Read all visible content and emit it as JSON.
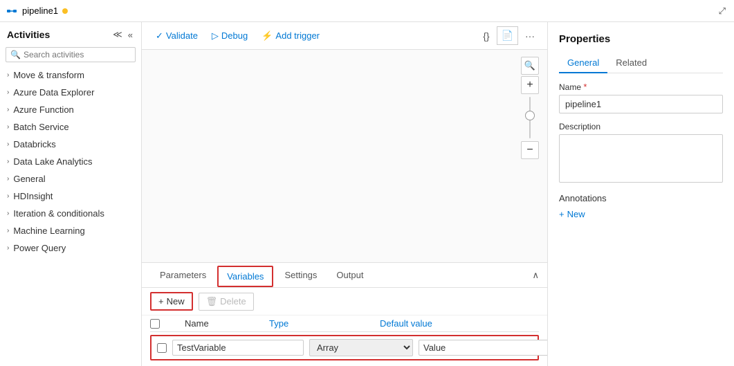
{
  "titleBar": {
    "icon": "pipeline-icon",
    "title": "pipeline1",
    "dot": true,
    "maximizeBtn": "⤢",
    "moreBtn": "..."
  },
  "toolbar": {
    "validateLabel": "Validate",
    "debugLabel": "Debug",
    "addTriggerLabel": "Add trigger",
    "codeBtn": "{}",
    "docBtn": "📄",
    "moreBtn": "···"
  },
  "sidebar": {
    "title": "Activities",
    "searchPlaceholder": "Search activities",
    "collapseBtn": "«",
    "expandBtn": "≪",
    "items": [
      {
        "label": "Move & transform"
      },
      {
        "label": "Azure Data Explorer"
      },
      {
        "label": "Azure Function"
      },
      {
        "label": "Batch Service"
      },
      {
        "label": "Databricks"
      },
      {
        "label": "Data Lake Analytics"
      },
      {
        "label": "General"
      },
      {
        "label": "HDInsight"
      },
      {
        "label": "Iteration & conditionals"
      },
      {
        "label": "Machine Learning"
      },
      {
        "label": "Power Query"
      }
    ]
  },
  "bottomPanel": {
    "tabs": [
      {
        "label": "Parameters",
        "active": false
      },
      {
        "label": "Variables",
        "active": true
      },
      {
        "label": "Settings",
        "active": false
      },
      {
        "label": "Output",
        "active": false
      }
    ],
    "newBtn": "+ New",
    "deleteBtn": "Delete",
    "table": {
      "headers": [
        "Name",
        "Type",
        "Default value"
      ],
      "rows": [
        {
          "name": "TestVariable",
          "type": "Array",
          "default": "Value"
        }
      ]
    }
  },
  "properties": {
    "title": "Properties",
    "tabs": [
      {
        "label": "General",
        "active": true
      },
      {
        "label": "Related",
        "active": false
      }
    ],
    "nameLabel": "Name",
    "nameValue": "pipeline1",
    "descriptionLabel": "Description",
    "descriptionValue": "",
    "annotationsLabel": "Annotations",
    "newAnnotationBtn": "+ New"
  },
  "zoom": {
    "searchBtn": "🔍",
    "plusBtn": "+",
    "minusBtn": "−"
  }
}
